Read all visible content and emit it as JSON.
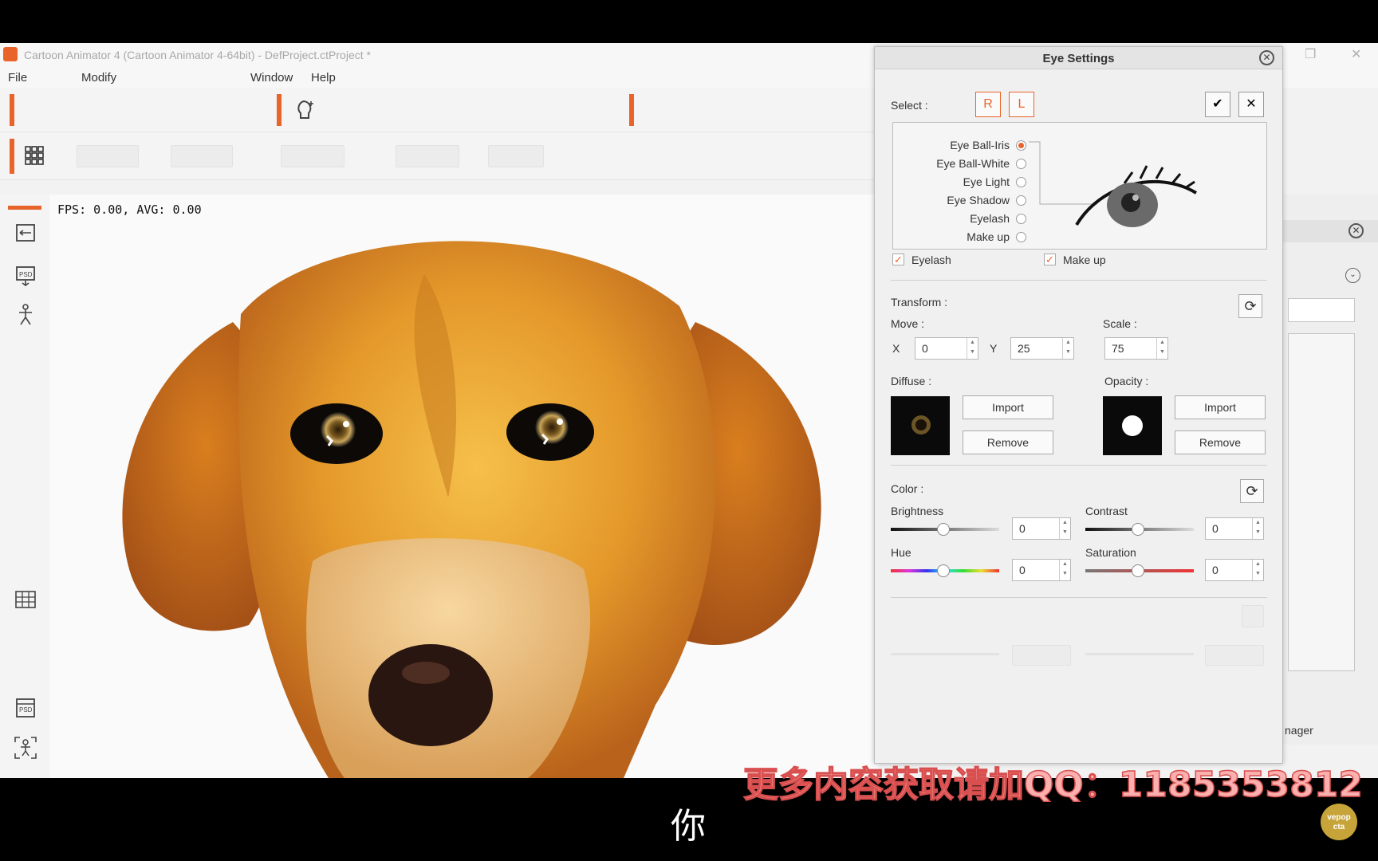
{
  "window": {
    "title": "Cartoon Animator 4  (Cartoon Animator 4-64bit) - DefProject.ctProject *",
    "restore_glyph": "❐",
    "close_glyph": "✕"
  },
  "menu": [
    {
      "label": "File"
    },
    {
      "label": "Modify"
    },
    {
      "label": "Window"
    },
    {
      "label": "Help"
    }
  ],
  "viewport": {
    "fps_text": "FPS: 0.00, AVG: 0.00"
  },
  "right_panel": {
    "partial_label": "nager"
  },
  "eye_settings": {
    "title": "Eye Settings",
    "select_label": "Select :",
    "select_buttons": [
      {
        "icon": "right-eye-icon",
        "glyph": "R"
      },
      {
        "icon": "left-eye-icon",
        "glyph": "L"
      },
      {
        "icon": "eye-check-icon",
        "glyph": "✔"
      },
      {
        "icon": "eye-close-icon",
        "glyph": "✕"
      }
    ],
    "parts": [
      {
        "label": "Eye Ball-Iris",
        "selected": true
      },
      {
        "label": "Eye Ball-White",
        "selected": false
      },
      {
        "label": "Eye Light",
        "selected": false
      },
      {
        "label": "Eye Shadow",
        "selected": false
      },
      {
        "label": "Eyelash",
        "selected": false
      },
      {
        "label": "Make up",
        "selected": false
      }
    ],
    "toggles": [
      {
        "label": "Eyelash",
        "checked": true
      },
      {
        "label": "Make up",
        "checked": true
      }
    ],
    "transform": {
      "label": "Transform :",
      "move_label": "Move :",
      "x_label": "X",
      "x_value": "0",
      "y_label": "Y",
      "y_value": "25",
      "scale_label": "Scale :",
      "scale_value": "75"
    },
    "diffuse": {
      "label": "Diffuse :",
      "import": "Import",
      "remove": "Remove"
    },
    "opacity": {
      "label": "Opacity :",
      "import": "Import",
      "remove": "Remove"
    },
    "color": {
      "label": "Color :",
      "brightness": {
        "label": "Brightness",
        "value": "0"
      },
      "contrast": {
        "label": "Contrast",
        "value": "0"
      },
      "hue": {
        "label": "Hue",
        "value": "0"
      },
      "saturation": {
        "label": "Saturation",
        "value": "0"
      }
    }
  },
  "overlay": {
    "subtitle": "你",
    "watermark": "更多内容获取请加QQ：1185353812",
    "corner_logo": "vepop cta"
  },
  "colors": {
    "accent": "#e8642a",
    "dog_fur": "#e09a2c"
  }
}
